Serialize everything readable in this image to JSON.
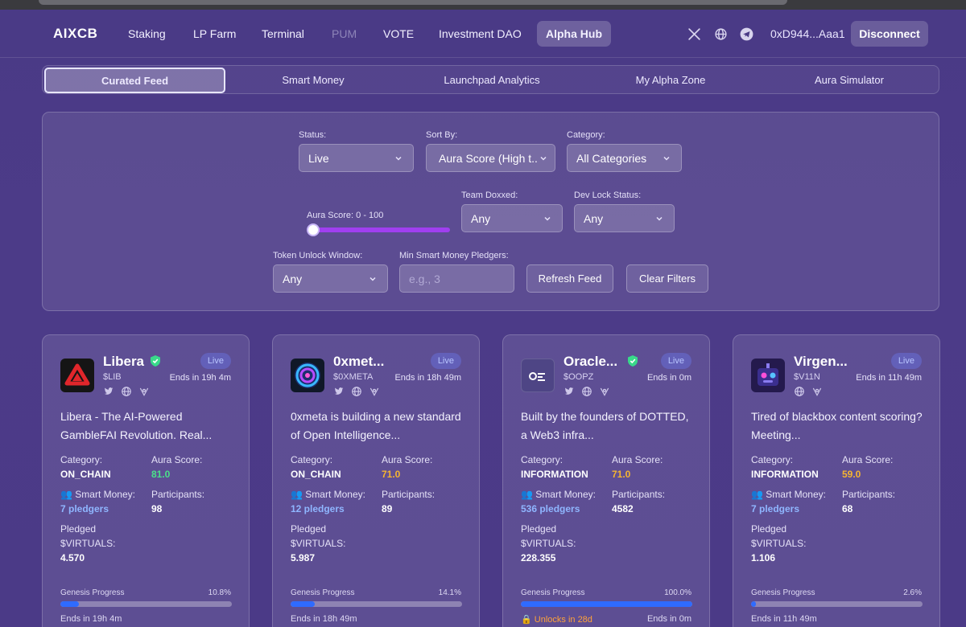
{
  "nav": {
    "logo": "AIXCB",
    "links": [
      {
        "label": "Staking"
      },
      {
        "label": "LP Farm"
      },
      {
        "label": "Terminal"
      },
      {
        "label": "PUM"
      },
      {
        "label": "VOTE"
      },
      {
        "label": "Investment DAO"
      },
      {
        "label": "Alpha Hub"
      }
    ],
    "icons": [
      "x-icon",
      "globe-icon",
      "telegram-icon"
    ],
    "wallet": "0xD944...Aaa1",
    "disconnect": "Disconnect"
  },
  "tabs": [
    "Curated Feed",
    "Smart Money",
    "Launchpad Analytics",
    "My Alpha Zone",
    "Aura Simulator"
  ],
  "filters": {
    "status": {
      "label": "Status:",
      "value": "Live"
    },
    "sort": {
      "label": "Sort By:",
      "value": "Aura Score (High t..."
    },
    "category": {
      "label": "Category:",
      "value": "All Categories"
    },
    "aura": {
      "label": "Aura Score: 0 - 100"
    },
    "team": {
      "label": "Team Doxxed:",
      "value": "Any"
    },
    "devlock": {
      "label": "Dev Lock Status:",
      "value": "Any"
    },
    "unlock": {
      "label": "Token Unlock Window:",
      "value": "Any"
    },
    "pledgers": {
      "label": "Min Smart Money Pledgers:",
      "placeholder": "e.g., 3"
    },
    "refresh": "Refresh Feed",
    "clear": "Clear Filters"
  },
  "labels": {
    "category": "Category:",
    "aura": "Aura Score:",
    "smart_money": "Smart Money:",
    "participants": "Participants:",
    "pledged": "Pledged",
    "pledged_unit": "$VIRTUALS:",
    "progress": "Genesis Progress"
  },
  "cards": [
    {
      "name": "Libera",
      "ticker": "$LIB",
      "status": "Live",
      "ends": "Ends in 19h 4m",
      "desc": "Libera - The AI-Powered GambleFAI Revolution. Real...",
      "category": "ON_CHAIN",
      "aura": "81.0",
      "aura_color": "#4be08a",
      "pledgers": "7 pledgers",
      "participants": "98",
      "pledged": "4.570",
      "progress_pct": "10.8%",
      "progress": 10.8,
      "foot_left": "Ends in 19h 4m",
      "foot_right": ""
    },
    {
      "name": "0xmet...",
      "ticker": "$0XMETA",
      "status": "Live",
      "ends": "Ends in 18h 49m",
      "desc": "0xmeta is building a new standard of Open Intelligence...",
      "category": "ON_CHAIN",
      "aura": "71.0",
      "aura_color": "#f5b431",
      "pledgers": "12 pledgers",
      "participants": "89",
      "pledged": "5.987",
      "progress_pct": "14.1%",
      "progress": 14.1,
      "foot_left": "Ends in 18h 49m",
      "foot_right": ""
    },
    {
      "name": "Oracle...",
      "ticker": "$OOPZ",
      "status": "Live",
      "ends": "Ends in 0m",
      "desc": "Built by the founders of DOTTED, a Web3 infra...",
      "category": "INFORMATION",
      "aura": "71.0",
      "aura_color": "#f5b431",
      "pledgers": "536 pledgers",
      "participants": "4582",
      "pledged": "228.355",
      "progress_pct": "100.0%",
      "progress": 100,
      "foot_left": "Unlocks in 28d",
      "foot_right": "Ends in 0m"
    },
    {
      "name": "Virgen...",
      "ticker": "$V11N",
      "status": "Live",
      "ends": "Ends in 11h 49m",
      "desc": "Tired of blackbox content scoring? Meeting...",
      "category": "INFORMATION",
      "aura": "59.0",
      "aura_color": "#f5b431",
      "pledgers": "7 pledgers",
      "participants": "68",
      "pledged": "1.106",
      "progress_pct": "2.6%",
      "progress": 2.6,
      "foot_left": "Ends in 11h 49m",
      "foot_right": ""
    }
  ]
}
